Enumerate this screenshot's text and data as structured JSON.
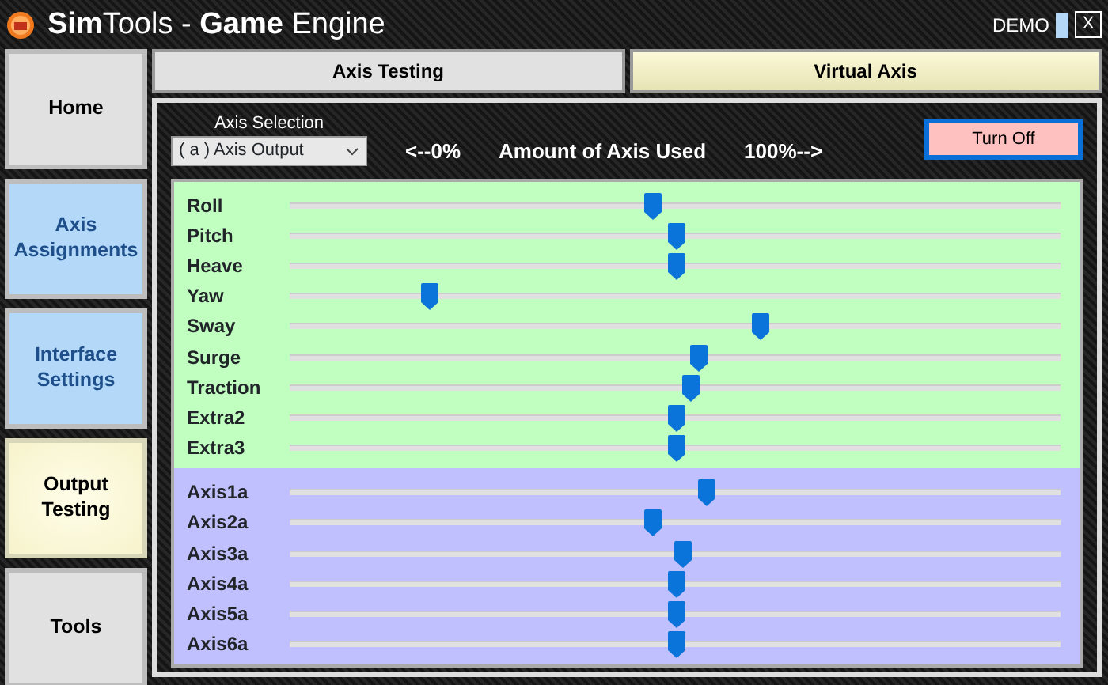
{
  "window": {
    "title": "**Sim**Tools - **Game** Engine",
    "badge": "DEMO",
    "close": "X"
  },
  "sidebar": {
    "items": [
      {
        "label": "Home",
        "selected": false,
        "color": "#e1e1e1"
      },
      {
        "label": "Axis Assignments",
        "selected": false,
        "color": "#b3d8f8"
      },
      {
        "label": "Interface Settings",
        "selected": false,
        "color": "#b3d8f8"
      },
      {
        "label": "Output Testing",
        "selected": true,
        "color": "#f6f3cc"
      },
      {
        "label": "Tools",
        "selected": false,
        "color": "#e1e1e1"
      }
    ]
  },
  "tabs": [
    {
      "label": "Axis Testing",
      "selected": false
    },
    {
      "label": "Virtual Axis",
      "selected": true
    }
  ],
  "axis_selection": {
    "label": "Axis Selection",
    "value": "( a ) Axis Output"
  },
  "scale": {
    "min": "<--0%",
    "title": "Amount of Axis Used",
    "max": "100%-->"
  },
  "turn_off_button": "Turn Off",
  "game_axes": [
    {
      "name": "Roll",
      "level": 0.47
    },
    {
      "name": "Pitch",
      "level": 0.5
    },
    {
      "name": "Heave",
      "level": 0.5
    },
    {
      "name": "Yaw",
      "level": 0.18
    },
    {
      "name": "Sway",
      "level": 0.61
    },
    {
      "name": "Surge",
      "level": 0.53
    },
    {
      "name": "Traction",
      "level": 0.52
    },
    {
      "name": "Extra2",
      "level": 0.5
    },
    {
      "name": "Extra3",
      "level": 0.5
    }
  ],
  "output_axes": [
    {
      "name": "Axis1a",
      "level": 0.54
    },
    {
      "name": "Axis2a",
      "level": 0.47
    },
    {
      "name": "Axis3a",
      "level": 0.51
    },
    {
      "name": "Axis4a",
      "level": 0.5
    },
    {
      "name": "Axis5a",
      "level": 0.5
    },
    {
      "name": "Axis6a",
      "level": 0.5
    }
  ]
}
